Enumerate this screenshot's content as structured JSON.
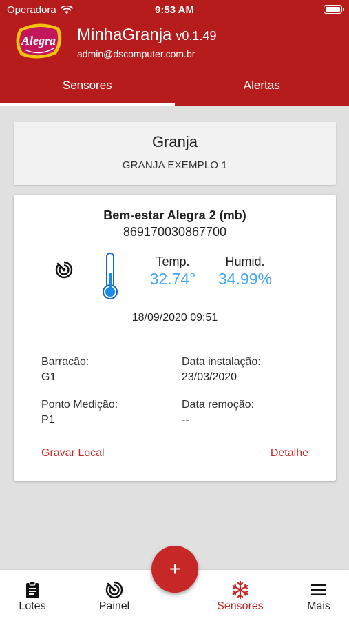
{
  "status_bar": {
    "carrier": "Operadora",
    "time": "9:53 AM"
  },
  "app": {
    "logo_text": "Alegra",
    "title": "MinhaGranja",
    "version": "v0.1.49",
    "email": "admin@dscomputer.com.br"
  },
  "tabs": [
    {
      "label": "Sensores",
      "active": true
    },
    {
      "label": "Alertas",
      "active": false
    }
  ],
  "granja": {
    "label": "Granja",
    "name": "GRANJA EXEMPLO 1"
  },
  "sensor": {
    "name": "Bem-estar Alegra 2 (mb)",
    "id": "869170030867700",
    "temp_label": "Temp.",
    "temp_value": "32.74°",
    "hum_label": "Humid.",
    "hum_value": "34.99%",
    "timestamp": "18/09/2020 09:51",
    "fields": {
      "barracao_label": "Barracão:",
      "barracao_value": "G1",
      "instalacao_label": "Data instalação:",
      "instalacao_value": "23/03/2020",
      "ponto_label": "Ponto Medição:",
      "ponto_value": "P1",
      "remocao_label": "Data remoção:",
      "remocao_value": "--"
    },
    "actions": {
      "gravar": "Gravar Local",
      "detalhe": "Detalhe"
    }
  },
  "fab": {
    "label": "+"
  },
  "bottom_nav": [
    {
      "label": "Lotes",
      "icon": "clipboard-icon"
    },
    {
      "label": "Painel",
      "icon": "radar-icon"
    },
    {
      "label": "Sensores",
      "icon": "snowflake-icon",
      "active": true
    },
    {
      "label": "Mais",
      "icon": "menu-icon"
    }
  ],
  "colors": {
    "primary": "#b71c1c",
    "accent": "#c62828",
    "value_blue": "#42a5f5"
  }
}
